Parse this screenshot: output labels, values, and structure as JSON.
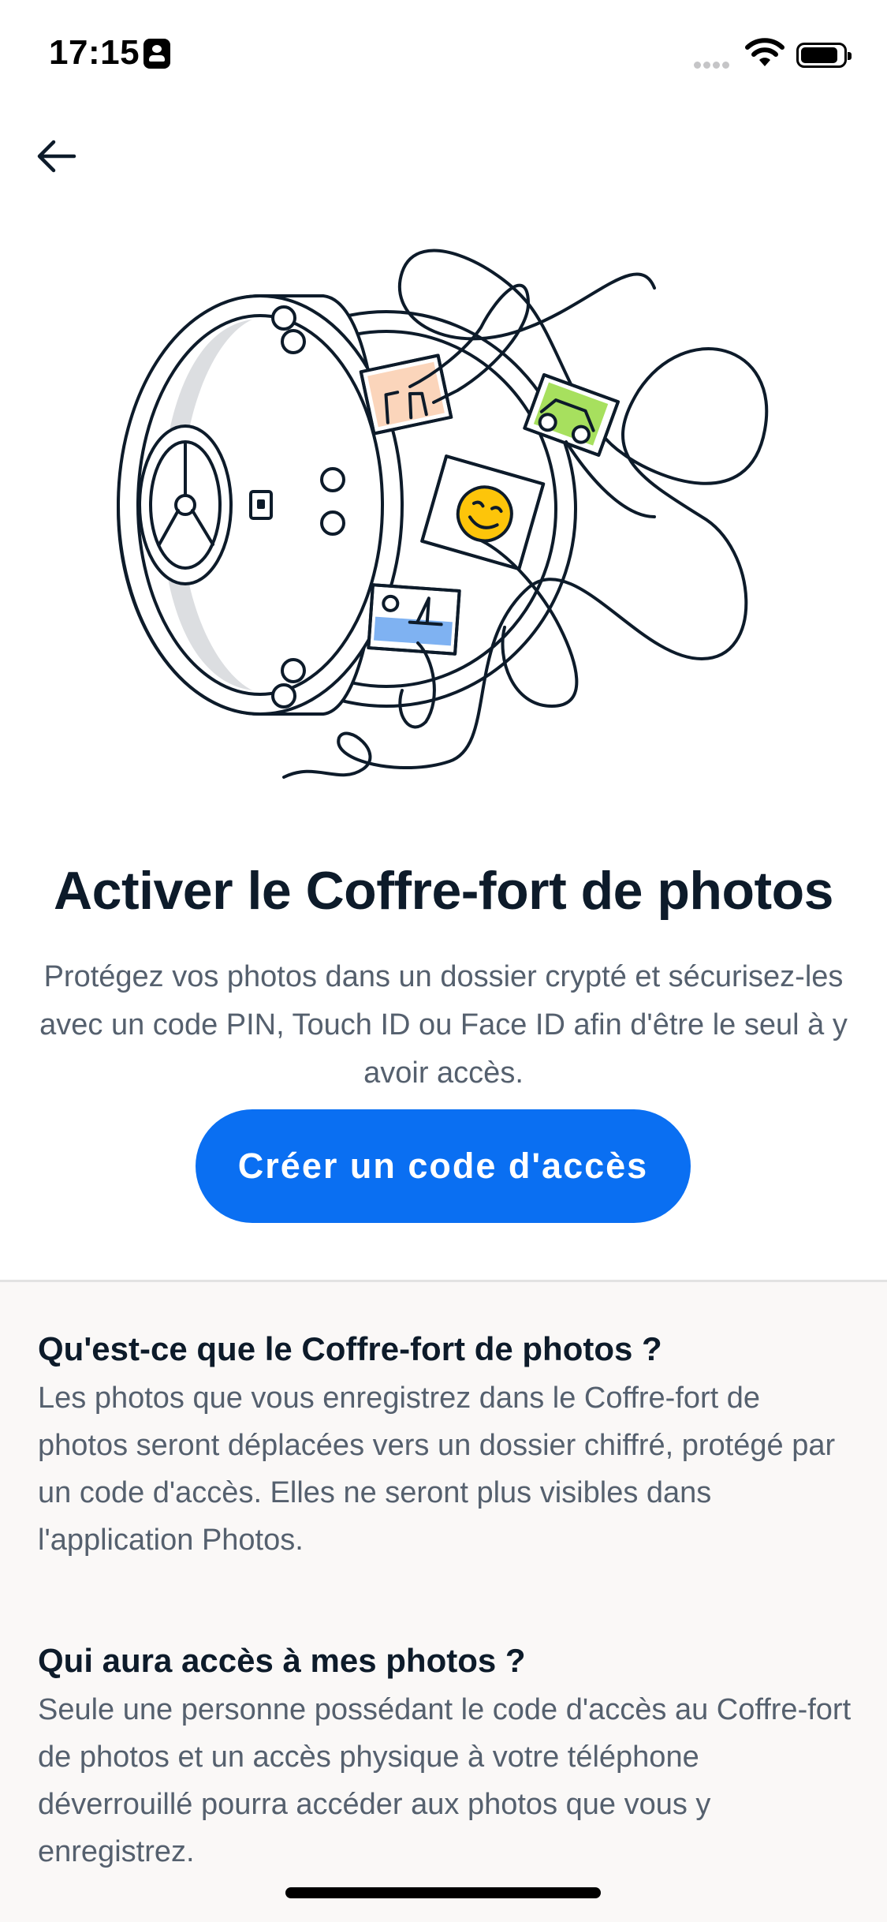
{
  "status_bar": {
    "time": "17:15"
  },
  "header": {
    "back_icon": "arrow-left-icon"
  },
  "hero": {
    "illustration": "photo-vault-safe-illustration",
    "colors": {
      "ink": "#0d1b2a",
      "safe_gray": "#dcdee1",
      "peach": "#fbd5bb",
      "green": "#a7e05e",
      "yellow": "#fdc50a",
      "blue": "#7fb2f2"
    }
  },
  "main": {
    "title": "Activer le Coffre-fort de photos",
    "description": "Protégez vos photos dans un dossier crypté et sécurisez-les avec un code PIN, Touch ID ou Face ID afin d'être le seul à y avoir accès.",
    "cta_label": "Créer un code d'accès",
    "accent_color": "#0a6ff2"
  },
  "faq": [
    {
      "question": "Qu'est-ce que le Coffre-fort de photos ?",
      "answer": "Les photos que vous enregistrez dans le Coffre-fort de photos seront déplacées vers un dossier chiffré, protégé par un code d'accès. Elles ne seront plus visibles dans l'application Photos."
    },
    {
      "question": "Qui aura accès à mes photos ?",
      "answer": "Seule une personne possédant le code d'accès au Coffre-fort de photos et un accès physique à votre téléphone déverrouillé pourra accéder aux photos que vous y enregistrez."
    }
  ]
}
